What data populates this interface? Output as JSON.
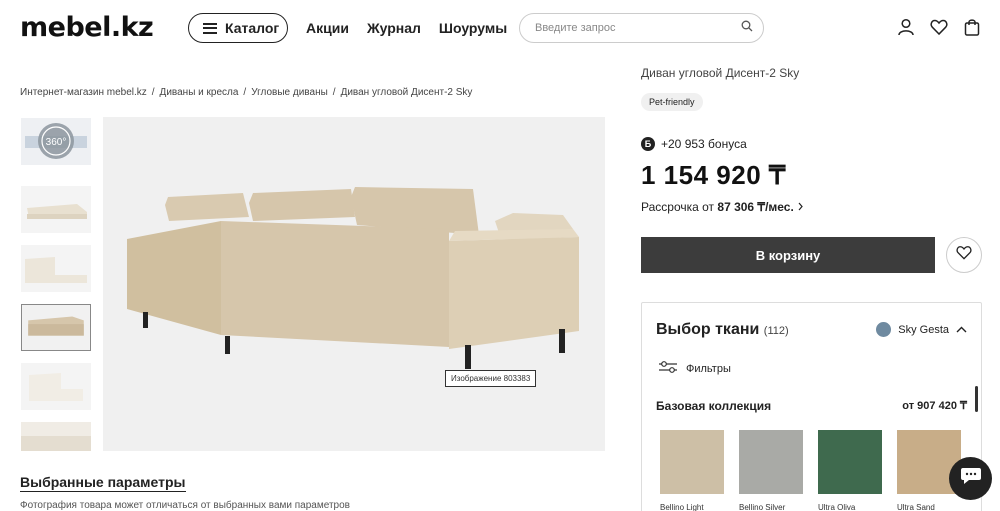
{
  "header": {
    "logo": "mebel.kz",
    "catalog_label": "Каталог",
    "nav": [
      "Акции",
      "Журнал",
      "Шоурумы"
    ],
    "search_placeholder": "Введите запрос"
  },
  "breadcrumb": [
    "Интернет-магазин mebel.kz",
    "Диваны и кресла",
    "Угловые диваны",
    "Диван угловой Дисент-2 Sky"
  ],
  "breadcrumb_sep": "/",
  "gallery": {
    "thumb_360_label": "360°",
    "image_caption": "Изображение 803383"
  },
  "params": {
    "title": "Выбранные параметры",
    "note": "Фотография товара может отличаться от выбранных вами параметров"
  },
  "product": {
    "title": "Диван угловой Дисент-2 Sky",
    "badge": "Pet-friendly",
    "bonus_icon": "Б",
    "bonus": "+20 953 бонуса",
    "price": "1 154 920 ₸",
    "installment_prefix": "Рассрочка от",
    "installment_value": "87 306 ₸/мес.",
    "cart_label": "В корзину"
  },
  "fabric": {
    "title": "Выбор ткани",
    "count": "(112)",
    "selected": "Sky Gesta",
    "selected_color": "#6f8aa0",
    "filters_label": "Фильтры",
    "collection": "Базовая коллекция",
    "collection_price": "от 907 420 ₸",
    "swatches": [
      {
        "label": "Bellino Light",
        "color": "#cdbfa6"
      },
      {
        "label": "Bellino Silver",
        "color": "#a9aaa6"
      },
      {
        "label": "Ultra Oliva",
        "color": "#3f6a4e"
      },
      {
        "label": "Ultra Sand",
        "color": "#c8ad88"
      }
    ]
  },
  "colors": {
    "sofa": "#d6c6ab",
    "cart_bg": "#3c3c3c"
  }
}
